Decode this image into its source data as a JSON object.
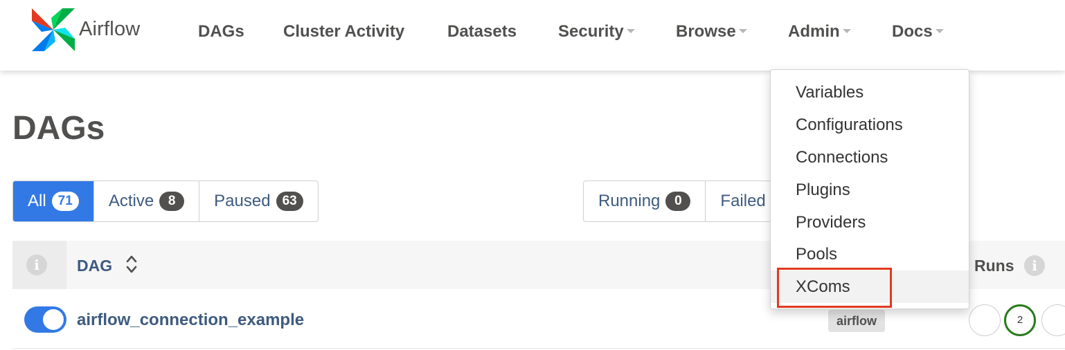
{
  "nav": {
    "brand": "Airflow",
    "items": [
      {
        "label": "DAGs",
        "has_caret": false
      },
      {
        "label": "Cluster Activity",
        "has_caret": false
      },
      {
        "label": "Datasets",
        "has_caret": false
      },
      {
        "label": "Security",
        "has_caret": true
      },
      {
        "label": "Browse",
        "has_caret": true
      },
      {
        "label": "Admin",
        "has_caret": true
      },
      {
        "label": "Docs",
        "has_caret": true
      }
    ]
  },
  "page": {
    "title": "DAGs"
  },
  "filters": {
    "status": [
      {
        "label": "All",
        "count": "71",
        "active": true
      },
      {
        "label": "Active",
        "count": "8",
        "active": false
      },
      {
        "label": "Paused",
        "count": "63",
        "active": false
      }
    ],
    "runs": [
      {
        "label": "Running",
        "count": "0"
      },
      {
        "label": "Failed",
        "count": ""
      }
    ]
  },
  "table": {
    "headers": {
      "dag": "DAG",
      "runs": "Runs",
      "info_glyph": "i"
    },
    "rows": [
      {
        "dag_id": "airflow_connection_example",
        "enabled": true,
        "tag": "airflow",
        "runs": [
          "",
          "2",
          ""
        ]
      }
    ]
  },
  "admin_menu": {
    "items": [
      "Variables",
      "Configurations",
      "Connections",
      "Plugins",
      "Providers",
      "Pools",
      "XComs"
    ],
    "hovered_index": 6
  },
  "colors": {
    "primary": "#3279e6",
    "link": "#3d5a80",
    "text": "#51504f",
    "success": "#2a7a1e",
    "highlight": "#e0391f"
  }
}
